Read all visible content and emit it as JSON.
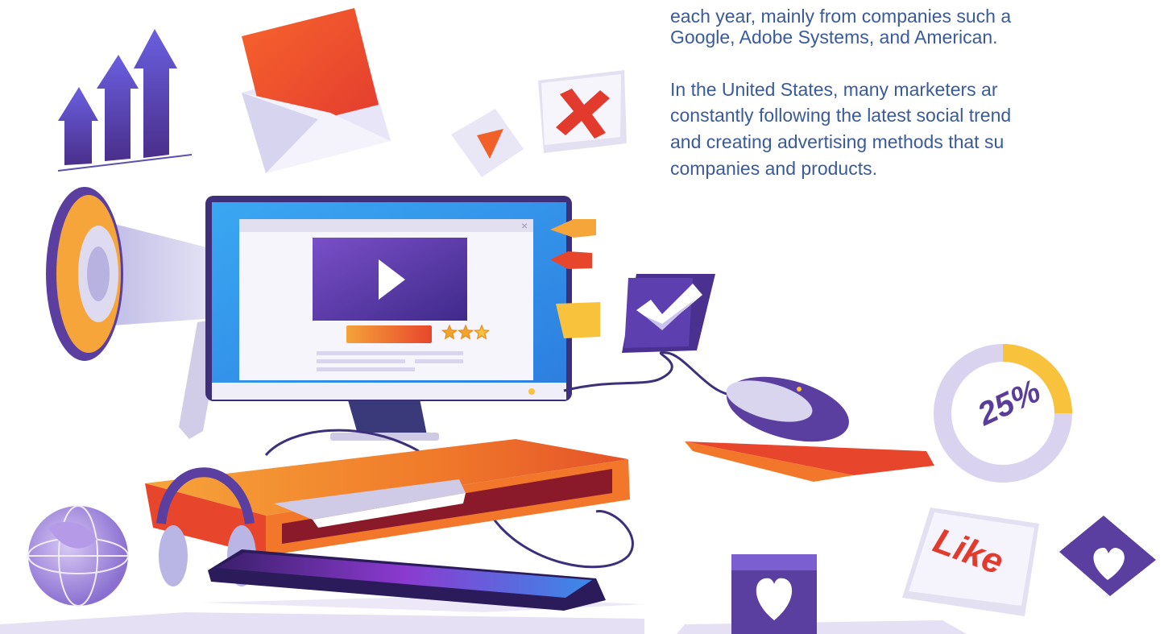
{
  "intro_lines": [
    "each year, mainly from companies such a",
    "Google, Adobe Systems, and American."
  ],
  "body_lines": [
    "In the United States, many marketers ar",
    "constantly following the latest social trend",
    "and creating advertising methods that su",
    "companies and products."
  ],
  "illustration": {
    "percent_label": "25%",
    "like_label": "Like",
    "rating_stars": 2.5,
    "rating_max": 3,
    "donut_fill_fraction": 0.25
  },
  "colors": {
    "text": "#3a5a9a",
    "purple": "#5b3fa0",
    "orange": "#f2772a",
    "red": "#e23b2e",
    "yellow": "#f9c23c",
    "lilac": "#d9d3ef"
  }
}
